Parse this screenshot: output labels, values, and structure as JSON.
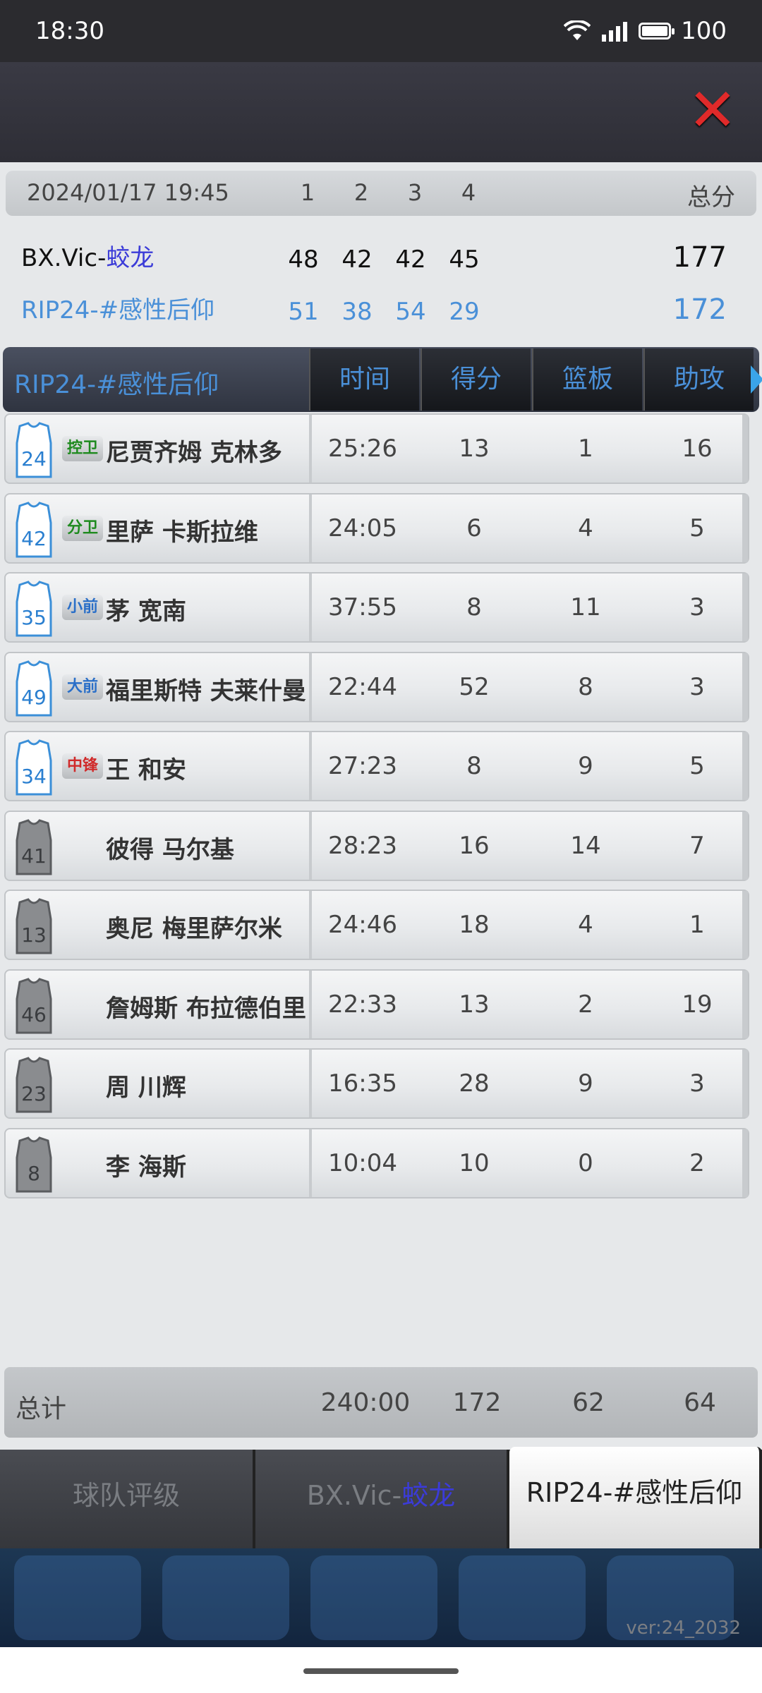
{
  "status": {
    "time": "18:30",
    "battery": "100"
  },
  "score": {
    "datetime": "2024/01/17 19:45",
    "quarters": [
      "1",
      "2",
      "3",
      "4"
    ],
    "total_label": "总分",
    "home": {
      "name_prefix": "BX.Vic-",
      "name_suffix": "蛟龙",
      "q": [
        "48",
        "42",
        "42",
        "45"
      ],
      "total": "177"
    },
    "away": {
      "name": "RIP24-#感性后仰",
      "q": [
        "51",
        "38",
        "54",
        "29"
      ],
      "total": "172"
    }
  },
  "table": {
    "team": "RIP24-#感性后仰",
    "columns": [
      "时间",
      "得分",
      "篮板",
      "助攻"
    ],
    "rows": [
      {
        "number": "24",
        "position": "控卫",
        "name": "尼贾齐姆 克林多",
        "time": "25:26",
        "points": "13",
        "rebounds": "1",
        "assists": "16",
        "starter": true,
        "pos_color": "#1e8a1e"
      },
      {
        "number": "42",
        "position": "分卫",
        "name": "里萨 卡斯拉维",
        "time": "24:05",
        "points": "6",
        "rebounds": "4",
        "assists": "5",
        "starter": true,
        "pos_color": "#1e8a1e"
      },
      {
        "number": "35",
        "position": "小前",
        "name": "茅 宽南",
        "time": "37:55",
        "points": "8",
        "rebounds": "11",
        "assists": "3",
        "starter": true,
        "pos_color": "#2a6fc8"
      },
      {
        "number": "49",
        "position": "大前",
        "name": "福里斯特 夫莱什曼",
        "time": "22:44",
        "points": "52",
        "rebounds": "8",
        "assists": "3",
        "starter": true,
        "pos_color": "#2a6fc8"
      },
      {
        "number": "34",
        "position": "中锋",
        "name": "王 和安",
        "time": "27:23",
        "points": "8",
        "rebounds": "9",
        "assists": "5",
        "starter": true,
        "pos_color": "#d02a2a"
      },
      {
        "number": "41",
        "position": "",
        "name": "彼得 马尔基",
        "time": "28:23",
        "points": "16",
        "rebounds": "14",
        "assists": "7",
        "starter": false,
        "pos_color": ""
      },
      {
        "number": "13",
        "position": "",
        "name": "奥尼 梅里萨尔米",
        "time": "24:46",
        "points": "18",
        "rebounds": "4",
        "assists": "1",
        "starter": false,
        "pos_color": ""
      },
      {
        "number": "46",
        "position": "",
        "name": "詹姆斯 布拉德伯里",
        "time": "22:33",
        "points": "13",
        "rebounds": "2",
        "assists": "19",
        "starter": false,
        "pos_color": ""
      },
      {
        "number": "23",
        "position": "",
        "name": "周 川辉",
        "time": "16:35",
        "points": "28",
        "rebounds": "9",
        "assists": "3",
        "starter": false,
        "pos_color": ""
      },
      {
        "number": "8",
        "position": "",
        "name": "李 海斯",
        "time": "10:04",
        "points": "10",
        "rebounds": "0",
        "assists": "2",
        "starter": false,
        "pos_color": ""
      }
    ],
    "totals": {
      "label": "总计",
      "time": "240:00",
      "points": "172",
      "rebounds": "62",
      "assists": "64"
    }
  },
  "tabs": {
    "team_rating": "球队评级",
    "home_prefix": "BX.Vic-",
    "home_suffix": "蛟龙",
    "away": "RIP24-#感性后仰"
  },
  "version": "ver:24_2032"
}
